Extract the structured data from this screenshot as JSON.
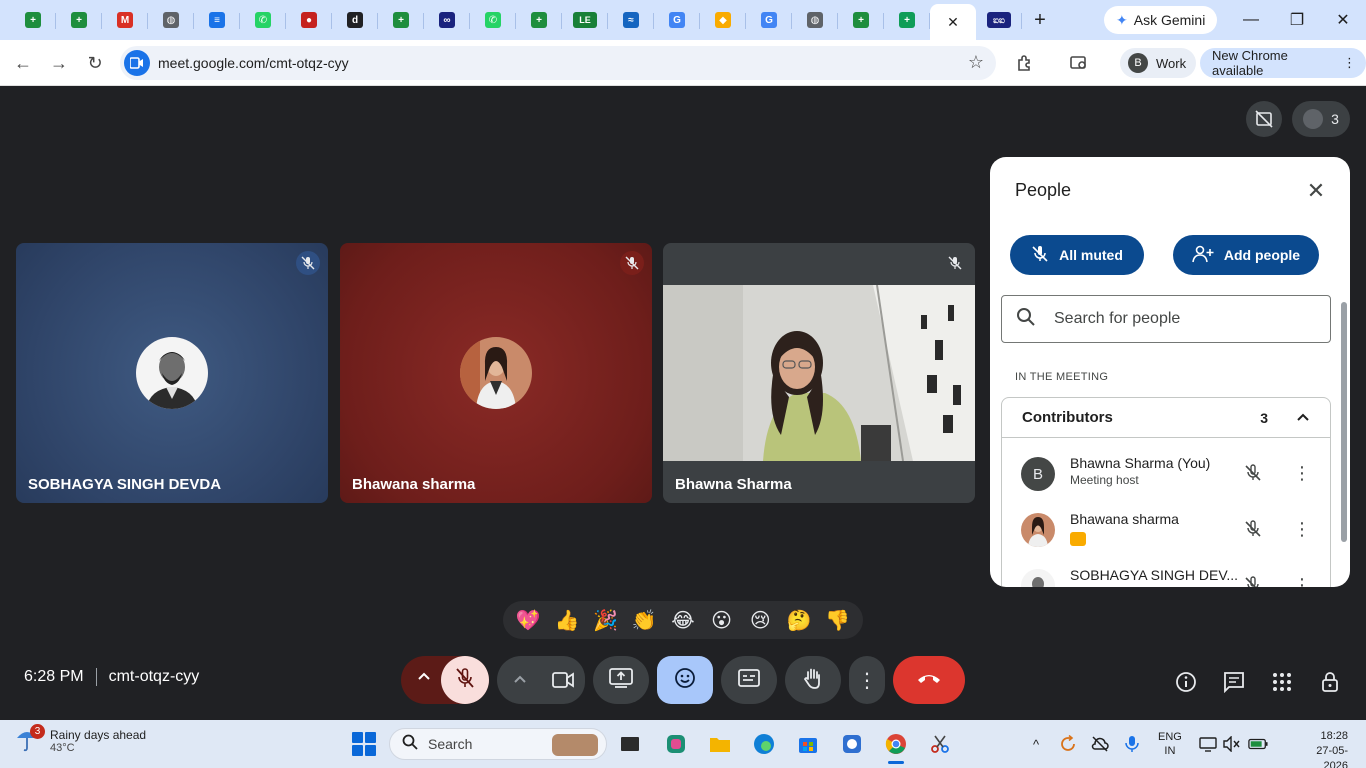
{
  "browser": {
    "tabs": [
      {
        "icon": "sheets-icon",
        "color": "#1e8e3e",
        "glyph": "+"
      },
      {
        "icon": "sheets-icon",
        "color": "#1e8e3e",
        "glyph": "+"
      },
      {
        "icon": "gmail-icon",
        "color": "#d93025",
        "glyph": "M"
      },
      {
        "icon": "globe-icon",
        "color": "#5f6368",
        "glyph": "◍"
      },
      {
        "icon": "docs-icon",
        "color": "#1a73e8",
        "glyph": "≡"
      },
      {
        "icon": "whatsapp-icon",
        "color": "#25d366",
        "glyph": "✆"
      },
      {
        "icon": "app-icon",
        "color": "#c5221f",
        "glyph": "●"
      },
      {
        "icon": "d-icon",
        "color": "#202124",
        "glyph": "d"
      },
      {
        "icon": "sheets-icon",
        "color": "#1e8e3e",
        "glyph": "+"
      },
      {
        "icon": "infinity-icon",
        "color": "#1a237e",
        "glyph": "∞"
      },
      {
        "icon": "whatsapp-icon",
        "color": "#25d366",
        "glyph": "✆"
      },
      {
        "icon": "sheets-icon",
        "color": "#1e8e3e",
        "glyph": "+"
      },
      {
        "icon": "le-icon",
        "color": "#188038",
        "glyph": "LE"
      },
      {
        "icon": "wave-icon",
        "color": "#1565c0",
        "glyph": "≈"
      },
      {
        "icon": "google-icon",
        "color": "#4285f4",
        "glyph": "G"
      },
      {
        "icon": "shield-icon",
        "color": "#f9ab00",
        "glyph": "◆"
      },
      {
        "icon": "google-icon",
        "color": "#4285f4",
        "glyph": "G"
      },
      {
        "icon": "globe-icon",
        "color": "#5f6368",
        "glyph": "◍"
      },
      {
        "icon": "sheets-icon",
        "color": "#1e8e3e",
        "glyph": "+"
      },
      {
        "icon": "sheets-icon",
        "color": "#0f9d58",
        "glyph": "+"
      },
      {
        "icon": "close-icon",
        "color": "#ffffff",
        "glyph": "✕",
        "active": true
      },
      {
        "icon": "kannada-icon",
        "color": "#1a237e",
        "glyph": "ಐಐ"
      }
    ],
    "new_tab_glyph": "+",
    "ask_gemini_label": "Ask Gemini",
    "url": "meet.google.com/cmt-otqz-cyy",
    "profile_initial": "B",
    "profile_label": "Work",
    "new_chrome_label": "New Chrome available"
  },
  "meet": {
    "participant_count": "3",
    "tiles": [
      {
        "name": "SOBHAGYA SINGH DEVDA"
      },
      {
        "name": "Bhawana sharma"
      },
      {
        "name": "Bhawna Sharma"
      }
    ],
    "people_panel": {
      "title": "People",
      "all_muted_label": "All muted",
      "add_people_label": "Add people",
      "search_placeholder": "Search for people",
      "section_label": "IN THE MEETING",
      "group_label": "Contributors",
      "group_count": "3",
      "people": [
        {
          "name": "Bhawna Sharma (You)",
          "role": "Meeting host",
          "initial": "B"
        },
        {
          "name": "Bhawana sharma",
          "role": ""
        },
        {
          "name": "SOBHAGYA SINGH DEV...",
          "role": ""
        }
      ]
    },
    "reactions": [
      "💖",
      "👍",
      "🎉",
      "👏",
      "😂",
      "😮",
      "😢",
      "🤔",
      "👎"
    ],
    "time": "6:28 PM",
    "meeting_code": "cmt-otqz-cyy",
    "colors": {
      "leave": "#dc362e",
      "mic_off_bg": "#f9dedc",
      "accent": "#a8c7fa"
    }
  },
  "taskbar": {
    "weather_badge": "3",
    "weather_title": "Rainy days ahead",
    "weather_temp": "43°C",
    "search_label": "Search",
    "lang_line1": "ENG",
    "lang_line2": "IN",
    "time": "18:28",
    "date": "27-05-2026"
  }
}
